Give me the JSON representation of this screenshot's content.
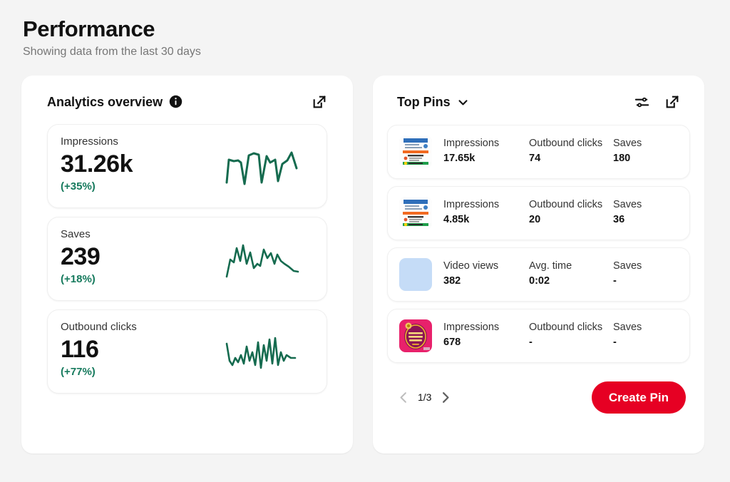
{
  "header": {
    "title": "Performance",
    "subtitle": "Showing data from the last 30 days"
  },
  "analytics": {
    "title": "Analytics overview",
    "info_icon": "info-icon",
    "expand_icon": "external-link-icon",
    "metrics": [
      {
        "label": "Impressions",
        "value": "31.26k",
        "delta": "(+35%)"
      },
      {
        "label": "Saves",
        "value": "239",
        "delta": "(+18%)"
      },
      {
        "label": "Outbound clicks",
        "value": "116",
        "delta": "(+77%)"
      }
    ]
  },
  "top_pins": {
    "title": "Top Pins",
    "dropdown_icon": "chevron-down-icon",
    "filter_icon": "sliders-icon",
    "expand_icon": "external-link-icon",
    "rows": [
      {
        "thumbnail": "flag-document-thumbnail",
        "stats": [
          {
            "label": "Impressions",
            "value": "17.65k"
          },
          {
            "label": "Outbound clicks",
            "value": "74"
          },
          {
            "label": "Saves",
            "value": "180"
          }
        ]
      },
      {
        "thumbnail": "flag-document-thumbnail",
        "stats": [
          {
            "label": "Impressions",
            "value": "4.85k"
          },
          {
            "label": "Outbound clicks",
            "value": "20"
          },
          {
            "label": "Saves",
            "value": "36"
          }
        ]
      },
      {
        "thumbnail": "blank-blue-thumbnail",
        "stats": [
          {
            "label": "Video views",
            "value": "382"
          },
          {
            "label": "Avg. time",
            "value": "0:02"
          },
          {
            "label": "Saves",
            "value": "-"
          }
        ]
      },
      {
        "thumbnail": "pink-greeting-thumbnail",
        "stats": [
          {
            "label": "Impressions",
            "value": "678"
          },
          {
            "label": "Outbound clicks",
            "value": "-"
          },
          {
            "label": "Saves",
            "value": "-"
          }
        ]
      }
    ],
    "pagination": {
      "prev_icon": "chevron-left-icon",
      "page_label": "1/3",
      "next_icon": "chevron-right-icon"
    },
    "create_button": "Create Pin"
  },
  "colors": {
    "brand_red": "#e60023",
    "sparkline_green": "#156b4f",
    "delta_green": "#167a5d",
    "page_bg": "#f4f4f4"
  },
  "chart_data": [
    {
      "type": "line",
      "title": "Impressions sparkline",
      "xlabel": "",
      "ylabel": "",
      "values": [
        18,
        55,
        50,
        52,
        10,
        68,
        72,
        70,
        12,
        70,
        62,
        66,
        16,
        52,
        62,
        58,
        74,
        40
      ],
      "ylim": [
        0,
        80
      ]
    },
    {
      "type": "line",
      "title": "Saves sparkline",
      "xlabel": "",
      "ylabel": "",
      "values": [
        8,
        40,
        36,
        62,
        40,
        78,
        34,
        60,
        22,
        30,
        26,
        70,
        46,
        58,
        30,
        56,
        40,
        34,
        26,
        14
      ],
      "ylim": [
        0,
        80
      ]
    },
    {
      "type": "line",
      "title": "Outbound clicks sparkline",
      "xlabel": "",
      "ylabel": "",
      "values": [
        52,
        26,
        18,
        34,
        24,
        40,
        20,
        56,
        24,
        44,
        18,
        64,
        10,
        58,
        22,
        70,
        18,
        76,
        16,
        40,
        22,
        36
      ],
      "ylim": [
        0,
        80
      ]
    }
  ]
}
